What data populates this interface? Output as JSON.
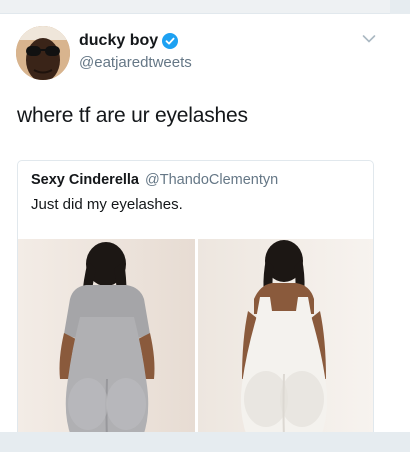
{
  "tweet": {
    "display_name": "ducky boy",
    "handle": "@eatjaredtweets",
    "verified": true,
    "text": "where tf are ur eyelashes"
  },
  "quoted_tweet": {
    "display_name": "Sexy Cinderella",
    "handle": "@ThandoClementyn",
    "text": "Just did my eyelashes.",
    "photos": [
      "grey-dress-back-view",
      "white-dress-back-view"
    ]
  },
  "colors": {
    "verified_blue": "#1da1f2",
    "secondary_text": "#657786",
    "border": "#e1e8ed"
  },
  "icons": [
    "verified-badge-icon",
    "chevron-down-icon"
  ]
}
